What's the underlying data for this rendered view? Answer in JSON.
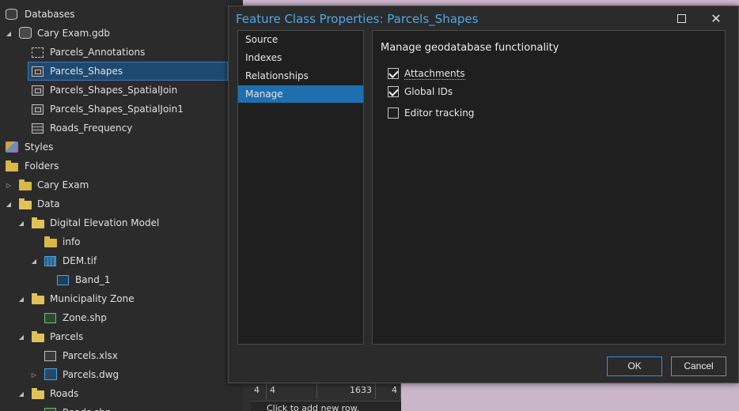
{
  "catalog": {
    "items": [
      {
        "label": "Databases",
        "icon": "database-icon",
        "expander": ""
      },
      {
        "label": "Cary Exam.gdb",
        "icon": "geodatabase-icon",
        "expander": "◢"
      },
      {
        "label": "Parcels_Annotations",
        "icon": "annotation-icon",
        "expander": ""
      },
      {
        "label": "Parcels_Shapes",
        "icon": "polygon-feature-class-icon",
        "expander": "",
        "selected": true
      },
      {
        "label": "Parcels_Shapes_SpatialJoin",
        "icon": "polygon-feature-class-icon",
        "expander": ""
      },
      {
        "label": "Parcels_Shapes_SpatialJoin1",
        "icon": "polygon-feature-class-icon",
        "expander": ""
      },
      {
        "label": "Roads_Frequency",
        "icon": "table-icon",
        "expander": ""
      },
      {
        "label": "Styles",
        "icon": "styles-icon",
        "expander": ""
      },
      {
        "label": "Folders",
        "icon": "folder-icon",
        "expander": ""
      },
      {
        "label": "Cary Exam",
        "icon": "folder-home-icon",
        "expander": "▷"
      },
      {
        "label": "Data",
        "icon": "folder-icon",
        "expander": "◢"
      },
      {
        "label": "Digital Elevation Model",
        "icon": "folder-icon",
        "expander": "◢"
      },
      {
        "label": "info",
        "icon": "folder-icon",
        "expander": ""
      },
      {
        "label": "DEM.tif",
        "icon": "raster-icon",
        "expander": "◢"
      },
      {
        "label": "Band_1",
        "icon": "raster-band-icon",
        "expander": ""
      },
      {
        "label": "Municipality Zone",
        "icon": "folder-icon",
        "expander": "◢"
      },
      {
        "label": "Zone.shp",
        "icon": "shapefile-icon",
        "expander": ""
      },
      {
        "label": "Parcels",
        "icon": "folder-icon",
        "expander": "◢"
      },
      {
        "label": "Parcels.xlsx",
        "icon": "excel-icon",
        "expander": ""
      },
      {
        "label": "Parcels.dwg",
        "icon": "cad-icon",
        "expander": "▷"
      },
      {
        "label": "Roads",
        "icon": "folder-icon",
        "expander": "◢"
      },
      {
        "label": "Roads.shp",
        "icon": "shapefile-icon",
        "expander": ""
      }
    ]
  },
  "attribute_table": {
    "cells": [
      "4",
      "4",
      "1633",
      "4"
    ],
    "add_row": "Click to add new row."
  },
  "dialog": {
    "title": "Feature Class Properties: Parcels_Shapes",
    "nav": [
      "Source",
      "Indexes",
      "Relationships",
      "Manage"
    ],
    "active_nav": "Manage",
    "section_title": "Manage geodatabase functionality",
    "options": [
      {
        "label": "Attachments",
        "checked": true
      },
      {
        "label": "Global IDs",
        "checked": true
      },
      {
        "label": "Editor tracking",
        "checked": false
      }
    ],
    "ok_label": "OK",
    "cancel_label": "Cancel"
  },
  "colors": {
    "title_blue": "#4fa8e8",
    "selection_blue": "#1e6fb0",
    "panel_bg": "#2b2b2b"
  }
}
